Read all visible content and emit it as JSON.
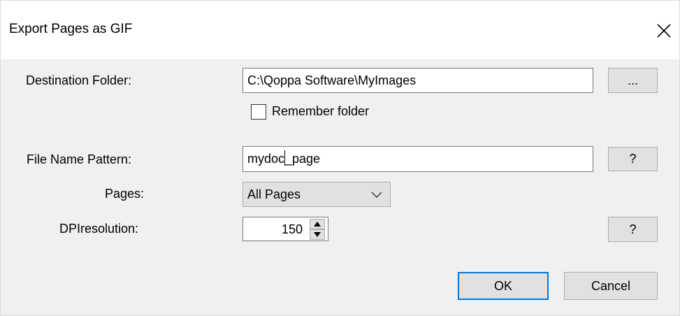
{
  "dialog": {
    "title": "Export Pages as GIF",
    "close_icon": "close-icon"
  },
  "destination": {
    "label": "Destination Folder:",
    "value": "C:\\Qoppa Software\\MyImages",
    "browse_label": "...",
    "remember_label": "Remember folder",
    "remember_checked": false
  },
  "file_name_pattern": {
    "label": "File Name Pattern:",
    "value_before_caret": "mydoc",
    "value_after_caret": "_page",
    "help_label": "?"
  },
  "pages": {
    "label": "Pages:",
    "selected": "All Pages",
    "chevron_icon": "chevron-down-icon"
  },
  "dpi": {
    "label": "DPIresolution:",
    "value": "150",
    "help_label": "?"
  },
  "buttons": {
    "ok_label": "OK",
    "cancel_label": "Cancel"
  },
  "colors": {
    "accent": "#0078d7",
    "dialog_bg": "#f0f0f0",
    "button_bg": "#e1e1e1"
  }
}
